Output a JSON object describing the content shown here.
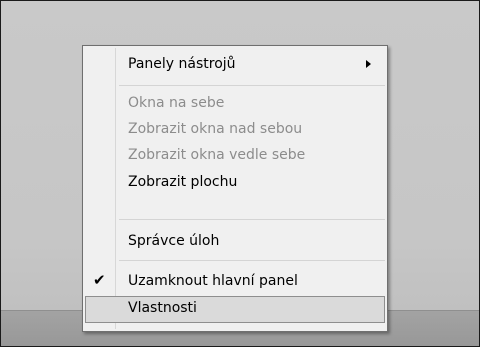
{
  "context_menu": {
    "items": [
      {
        "label": "Panely nástrojů"
      },
      {
        "label": "Okna na sebe"
      },
      {
        "label": "Zobrazit okna nad sebou"
      },
      {
        "label": "Zobrazit okna vedle sebe"
      },
      {
        "label": "Zobrazit plochu"
      },
      {
        "label": "Správce úloh"
      },
      {
        "label": "Uzamknout hlavní panel"
      },
      {
        "label": "Vlastnosti"
      }
    ],
    "checkmark": "✔"
  }
}
